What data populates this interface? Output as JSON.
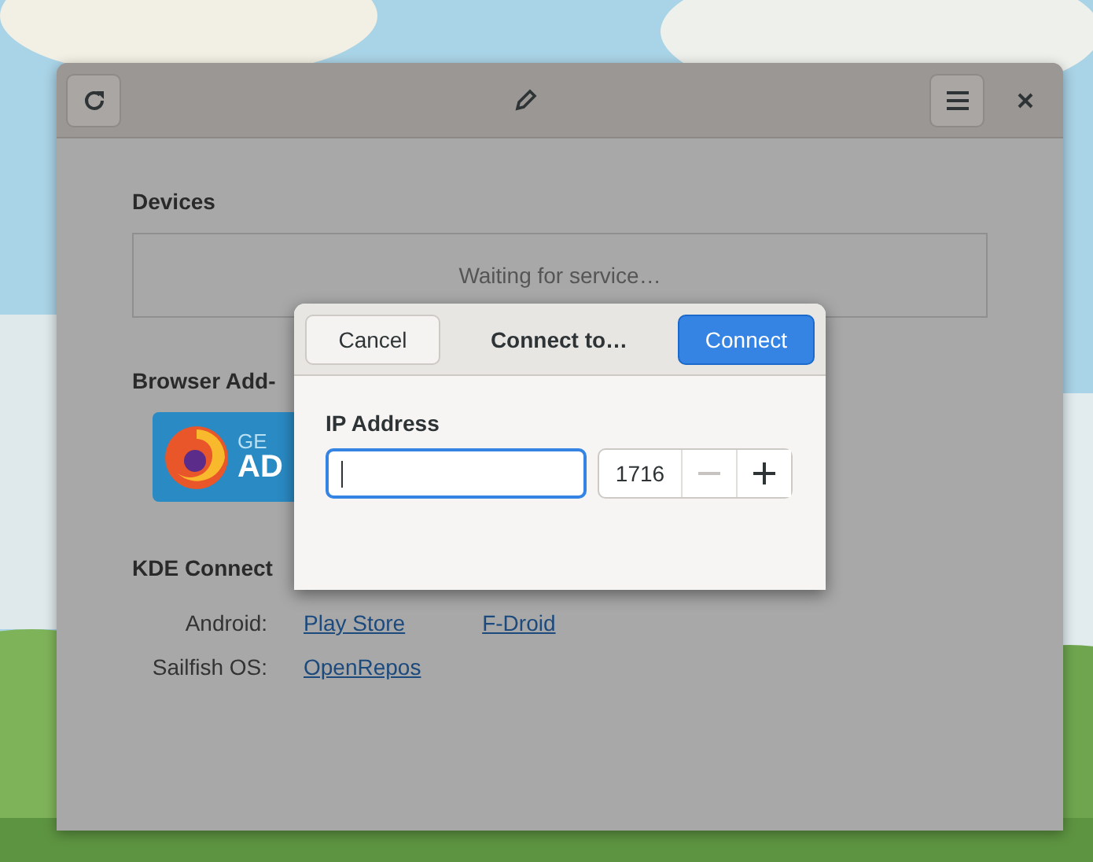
{
  "window": {
    "devices": {
      "heading": "Devices",
      "status": "Waiting for service…"
    },
    "addons": {
      "heading": "Browser Add-",
      "badge": {
        "line_1": "GE",
        "line_2": "AD"
      }
    },
    "kde_connect": {
      "heading": "KDE Connect",
      "rows": [
        {
          "label": "Android:",
          "links": [
            "Play Store",
            "F-Droid"
          ]
        },
        {
          "label": "Sailfish OS:",
          "links": [
            "OpenRepos"
          ]
        }
      ]
    }
  },
  "dialog": {
    "title": "Connect to…",
    "cancel": "Cancel",
    "confirm": "Connect",
    "field_label": "IP Address",
    "port": "1716"
  }
}
